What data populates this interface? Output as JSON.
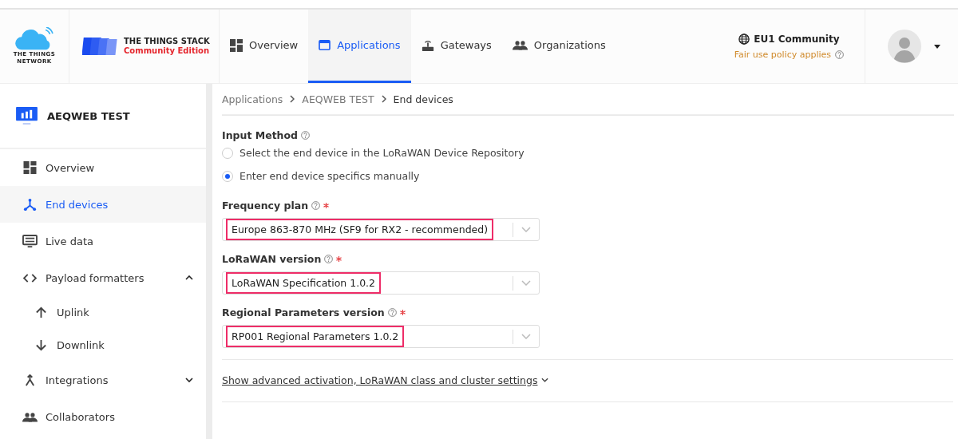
{
  "brand": {
    "network": [
      "THE THINGS",
      "NETWORK"
    ],
    "stack_title": "THE THINGS STACK",
    "stack_edition": "Community Edition"
  },
  "nav": [
    {
      "label": "Overview",
      "kind": "overview",
      "selected": false
    },
    {
      "label": "Applications",
      "kind": "applications",
      "selected": true
    },
    {
      "label": "Gateways",
      "kind": "gateways",
      "selected": false
    },
    {
      "label": "Organizations",
      "kind": "organizations",
      "selected": false
    }
  ],
  "cluster": {
    "name": "EU1 Community",
    "note": "Fair use policy applies"
  },
  "sidebar": {
    "title": "AEQWEB TEST",
    "items": [
      {
        "label": "Overview",
        "kind": "overview",
        "selected": false
      },
      {
        "label": "End devices",
        "kind": "devices",
        "selected": true
      },
      {
        "label": "Live data",
        "kind": "live",
        "selected": false
      },
      {
        "label": "Payload formatters",
        "kind": "code",
        "selected": false,
        "expanded": true,
        "children": [
          {
            "label": "Uplink",
            "kind": "up",
            "selected": false
          },
          {
            "label": "Downlink",
            "kind": "down",
            "selected": false
          }
        ]
      },
      {
        "label": "Integrations",
        "kind": "integrations",
        "selected": false,
        "expanded": false
      },
      {
        "label": "Collaborators",
        "kind": "people",
        "selected": false
      }
    ]
  },
  "breadcrumbs": [
    "Applications",
    "AEQWEB TEST",
    "End devices"
  ],
  "form": {
    "input_method": {
      "label": "Input Method",
      "options": [
        {
          "label": "Select the end device in the LoRaWAN Device Repository",
          "selected": false
        },
        {
          "label": "Enter end device specifics manually",
          "selected": true
        }
      ]
    },
    "selects": [
      {
        "label": "Frequency plan",
        "required": true,
        "value": "Europe 863-870 MHz (SF9 for RX2 - recommended)",
        "highlighted": true
      },
      {
        "label": "LoRaWAN version",
        "required": true,
        "value": "LoRaWAN Specification 1.0.2",
        "highlighted": true
      },
      {
        "label": "Regional Parameters version",
        "required": true,
        "value": "RP001 Regional Parameters 1.0.2",
        "highlighted": true
      }
    ],
    "advanced_link": "Show advanced activation, LoRaWAN class and cluster settings"
  }
}
